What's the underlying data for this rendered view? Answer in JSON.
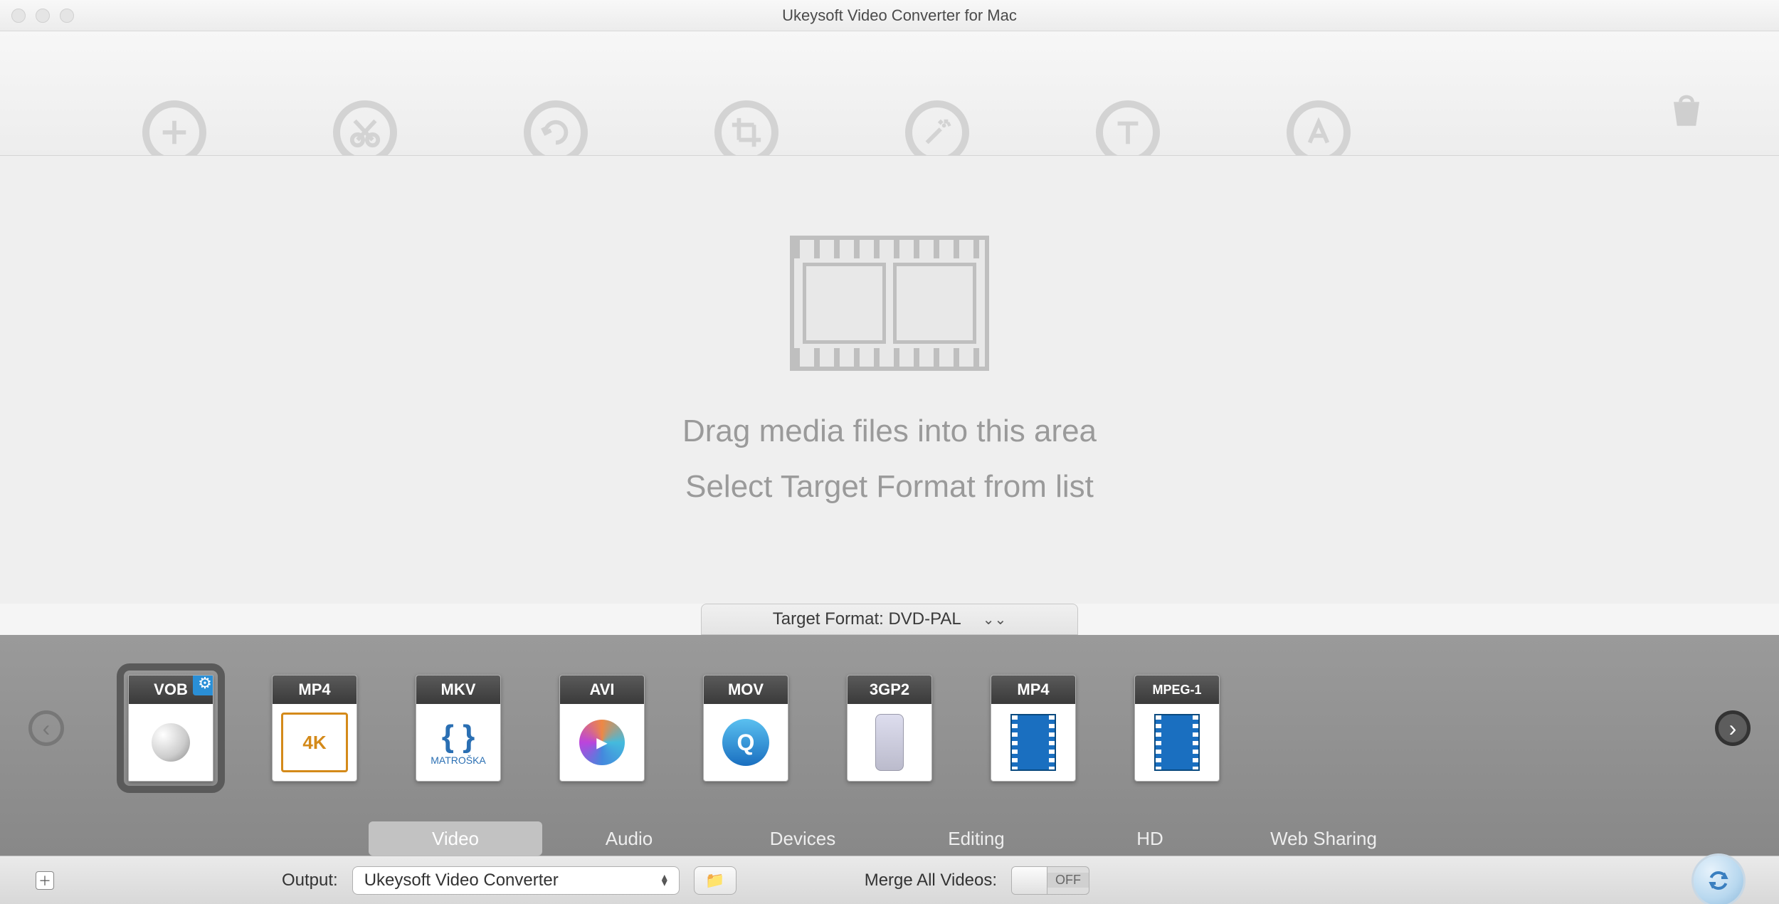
{
  "window": {
    "title": "Ukeysoft Video Converter for Mac"
  },
  "toolbar": {
    "icons": [
      "add",
      "cut",
      "rotate",
      "crop",
      "effect",
      "text",
      "font"
    ]
  },
  "drop": {
    "line1": "Drag media files into this area",
    "line2": "Select Target Format from list"
  },
  "target": {
    "label": "Target Format: DVD-PAL"
  },
  "formats": {
    "items": [
      {
        "code": "VOB",
        "selected": true
      },
      {
        "code": "MP4",
        "body": "4K"
      },
      {
        "code": "MKV",
        "body": "MATROŠKA"
      },
      {
        "code": "AVI"
      },
      {
        "code": "MOV"
      },
      {
        "code": "3GP2"
      },
      {
        "code": "MP4"
      },
      {
        "code": "MPEG-1"
      }
    ]
  },
  "categories": {
    "items": [
      {
        "label": "Video",
        "active": true
      },
      {
        "label": "Audio"
      },
      {
        "label": "Devices"
      },
      {
        "label": "Editing"
      },
      {
        "label": "HD"
      },
      {
        "label": "Web Sharing"
      }
    ]
  },
  "bottom": {
    "output_label": "Output:",
    "output_value": "Ukeysoft Video Converter",
    "merge_label": "Merge All Videos:",
    "toggle_state": "OFF"
  }
}
